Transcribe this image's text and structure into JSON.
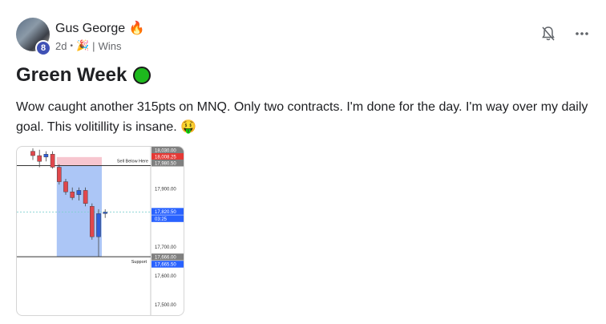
{
  "post": {
    "author": "Gus George",
    "author_flair": "🔥",
    "level": "8",
    "time": "2d",
    "category": "Wins",
    "title": "Green Week",
    "body": "Wow caught another 315pts on MNQ. Only two contracts. I'm done for the day. I'm way over my daily goal. This volitillity is insane. 🤑"
  },
  "header_icons": [
    "bell-off-icon",
    "more-icon"
  ],
  "chart_data": {
    "type": "candlestick",
    "annotations": [
      "Sell Below Here",
      "Support"
    ],
    "y_ticks": [
      17900.0,
      17700.0,
      17600.0,
      17500.0
    ],
    "y_tick_labels": [
      "17,900.00",
      "17,700.00",
      "17,600.00",
      "17,500.00"
    ],
    "price_tags": [
      {
        "label": "18,030.00",
        "color": "#808080"
      },
      {
        "label": "18,008.25",
        "color": "#e53935"
      },
      {
        "label": "17,980.50",
        "color": "#808080"
      },
      {
        "label": "17,820.50",
        "color": "#2962ff"
      },
      {
        "label": "03:25",
        "color": "#2962ff"
      },
      {
        "label": "17,666.00",
        "color": "#808080"
      },
      {
        "label": "17,665.50",
        "color": "#2962ff"
      }
    ],
    "levels": {
      "sell_below": 17980.5,
      "support": 17666.0,
      "current": 17820.5
    },
    "ylim": [
      17470,
      18040
    ],
    "candles": [
      {
        "o": 18030,
        "h": 18040,
        "l": 18000,
        "c": 18015
      },
      {
        "o": 18015,
        "h": 18035,
        "l": 17975,
        "c": 17995
      },
      {
        "o": 18010,
        "h": 18030,
        "l": 17995,
        "c": 18020
      },
      {
        "o": 18020,
        "h": 18030,
        "l": 17970,
        "c": 17975
      },
      {
        "o": 17975,
        "h": 17985,
        "l": 17915,
        "c": 17925
      },
      {
        "o": 17925,
        "h": 17935,
        "l": 17880,
        "c": 17890
      },
      {
        "o": 17890,
        "h": 17905,
        "l": 17862,
        "c": 17870
      },
      {
        "o": 17880,
        "h": 17905,
        "l": 17860,
        "c": 17895
      },
      {
        "o": 17895,
        "h": 17905,
        "l": 17840,
        "c": 17850
      },
      {
        "o": 17840,
        "h": 17850,
        "l": 17725,
        "c": 17735
      },
      {
        "o": 17735,
        "h": 17830,
        "l": 17665,
        "c": 17815
      },
      {
        "o": 17815,
        "h": 17830,
        "l": 17800,
        "c": 17820
      }
    ]
  }
}
